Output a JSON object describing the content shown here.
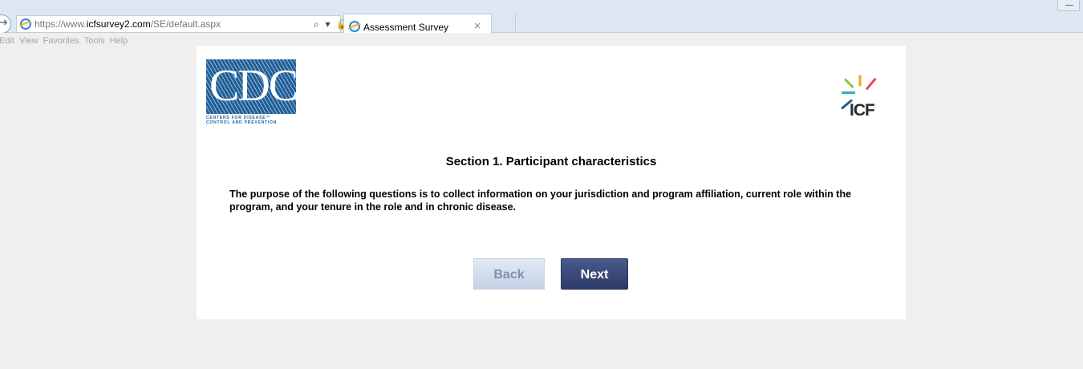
{
  "browser": {
    "url_prefix": "https://www.",
    "url_domain": "icfsurvey2.com",
    "url_path": "/SE/default.aspx",
    "address_controls": "⌕ ▾ 🔒 ↻",
    "tab_title": "Assessment Survey",
    "tab_close": "×",
    "menu": [
      "Edit",
      "View",
      "Favorites",
      "Tools",
      "Help"
    ]
  },
  "logos": {
    "cdc_text": "CDC",
    "cdc_caption_line1": "CENTERS FOR DISEASE™",
    "cdc_caption_line2": "CONTROL AND PREVENTION",
    "icf_text": "ICF"
  },
  "survey": {
    "section_title": "Section 1. Participant characteristics",
    "intro": "The purpose of the following questions is to collect information on your jurisdiction and program affiliation, current role within the program, and your tenure in the role and in chronic disease.",
    "back_label": "Back",
    "next_label": "Next",
    "back_enabled": false
  },
  "colors": {
    "cdc_blue": "#1d5e97",
    "next_button": "#2d3a67",
    "back_button_disabled": "#c5d2e6",
    "icf_rays": [
      "#e94e5b",
      "#f6a623",
      "#8dc63f",
      "#2bb3b1",
      "#1d5e97"
    ]
  }
}
